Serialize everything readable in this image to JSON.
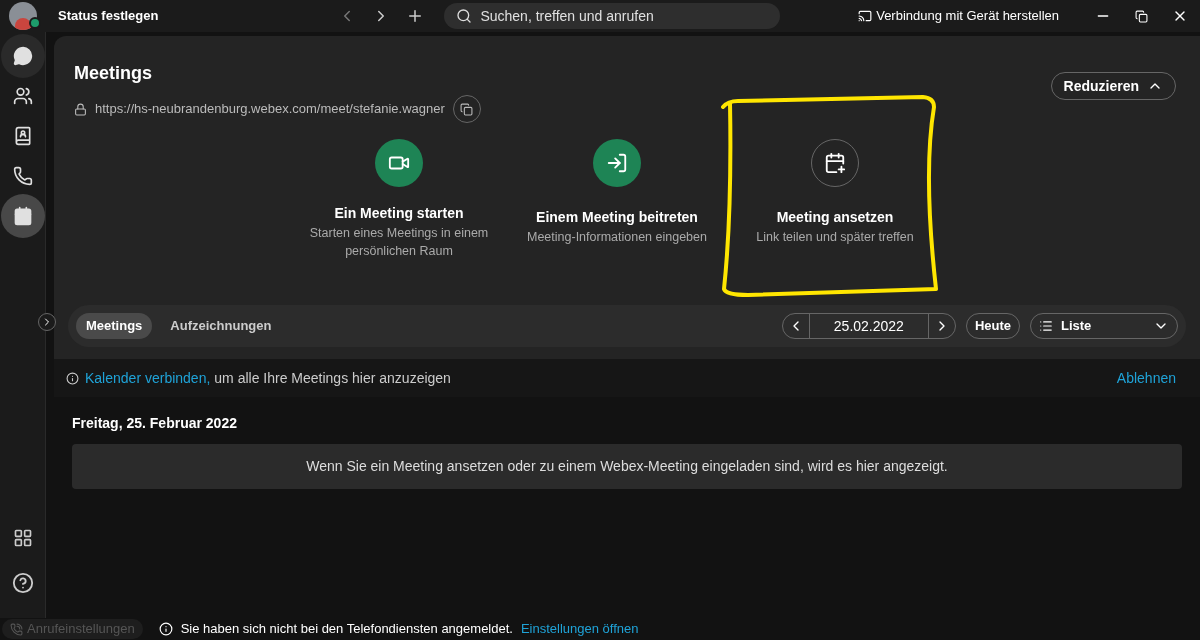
{
  "top_bar": {
    "status": "Status festlegen",
    "search": {
      "placeholder": "Suchen, treffen und anrufen"
    },
    "connect": "Verbindung mit Gerät herstellen"
  },
  "rail": [
    {
      "kind": "chat",
      "selected": false,
      "hovered": true
    },
    {
      "kind": "teams",
      "selected": false,
      "hovered": false
    },
    {
      "kind": "contacts",
      "selected": false,
      "hovered": false
    },
    {
      "kind": "phone",
      "selected": false,
      "hovered": false
    },
    {
      "kind": "calendar",
      "selected": true,
      "hovered": false
    }
  ],
  "header": {
    "title": "Meetings",
    "url": "https://hs-neubrandenburg.webex.com/meet/stefanie.wagner",
    "collapse": "Reduzieren"
  },
  "actions": [
    {
      "kind": "start",
      "title": "Ein Meeting starten",
      "subtitle": "Starten eines Meetings in einem persönlichen Raum",
      "highlighted": false
    },
    {
      "kind": "join",
      "title": "Einem Meeting beitreten",
      "subtitle": "Meeting-Informationen eingeben",
      "highlighted": false
    },
    {
      "kind": "schedule",
      "title": "Meeting ansetzen",
      "subtitle": "Link teilen und später treffen",
      "highlighted": true
    }
  ],
  "tabs": [
    {
      "label": "Meetings",
      "selected": true
    },
    {
      "label": "Aufzeichnungen",
      "selected": false
    }
  ],
  "date": "25.02.2022",
  "today": "Heute",
  "view": "Liste",
  "banner": {
    "link": "Kalender verbinden,",
    "text": "um alle Ihre Meetings hier anzuzeigen",
    "dismiss": "Ablehnen"
  },
  "day_header": "Freitag, 25. Februar 2022",
  "empty_message": "Wenn Sie ein Meeting ansetzen oder zu einem Webex-Meeting eingeladen sind, wird es hier angezeigt.",
  "status_bar": {
    "call_settings": "Anrufeinstellungen",
    "message": "Sie haben sich nicht bei den Telefondiensten angemeldet.",
    "link": "Einstellungen öffnen"
  }
}
